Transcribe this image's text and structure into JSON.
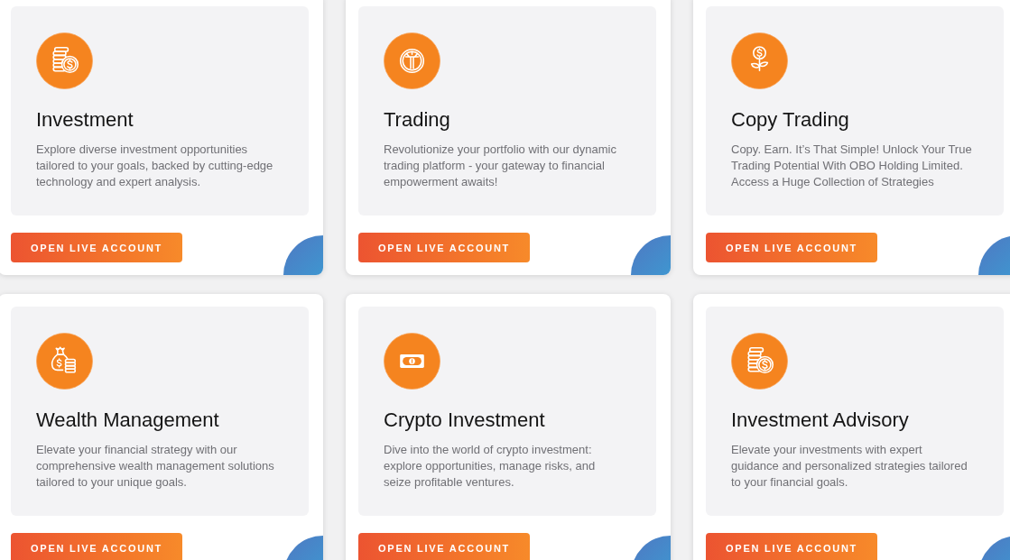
{
  "cards": [
    {
      "title": "Investment",
      "description": "Explore diverse investment opportunities tailored to your goals, backed by cutting-edge technology and expert analysis.",
      "button": "OPEN LIVE ACCOUNT"
    },
    {
      "title": "Trading",
      "description": "Revolutionize your portfolio with our dynamic trading platform - your gateway to financial empowerment awaits!",
      "button": "OPEN LIVE ACCOUNT"
    },
    {
      "title": "Copy Trading",
      "description": "Copy. Earn. It’s That Simple! Unlock Your True Trading Potential With OBO Holding Limited. Access a Huge Collection of Strategies",
      "button": "OPEN LIVE ACCOUNT"
    },
    {
      "title": "Wealth Management",
      "description": "Elevate your financial strategy with our comprehensive wealth management solutions tailored to your unique goals.",
      "button": "OPEN LIVE ACCOUNT"
    },
    {
      "title": "Crypto Investment",
      "description": "Dive into the world of crypto investment: explore opportunities, manage risks, and seize profitable ventures.",
      "button": "OPEN LIVE ACCOUNT"
    },
    {
      "title": "Investment Advisory",
      "description": "Elevate your investments with expert guidance and personalized strategies tailored to your financial goals.",
      "button": "OPEN LIVE ACCOUNT"
    }
  ]
}
